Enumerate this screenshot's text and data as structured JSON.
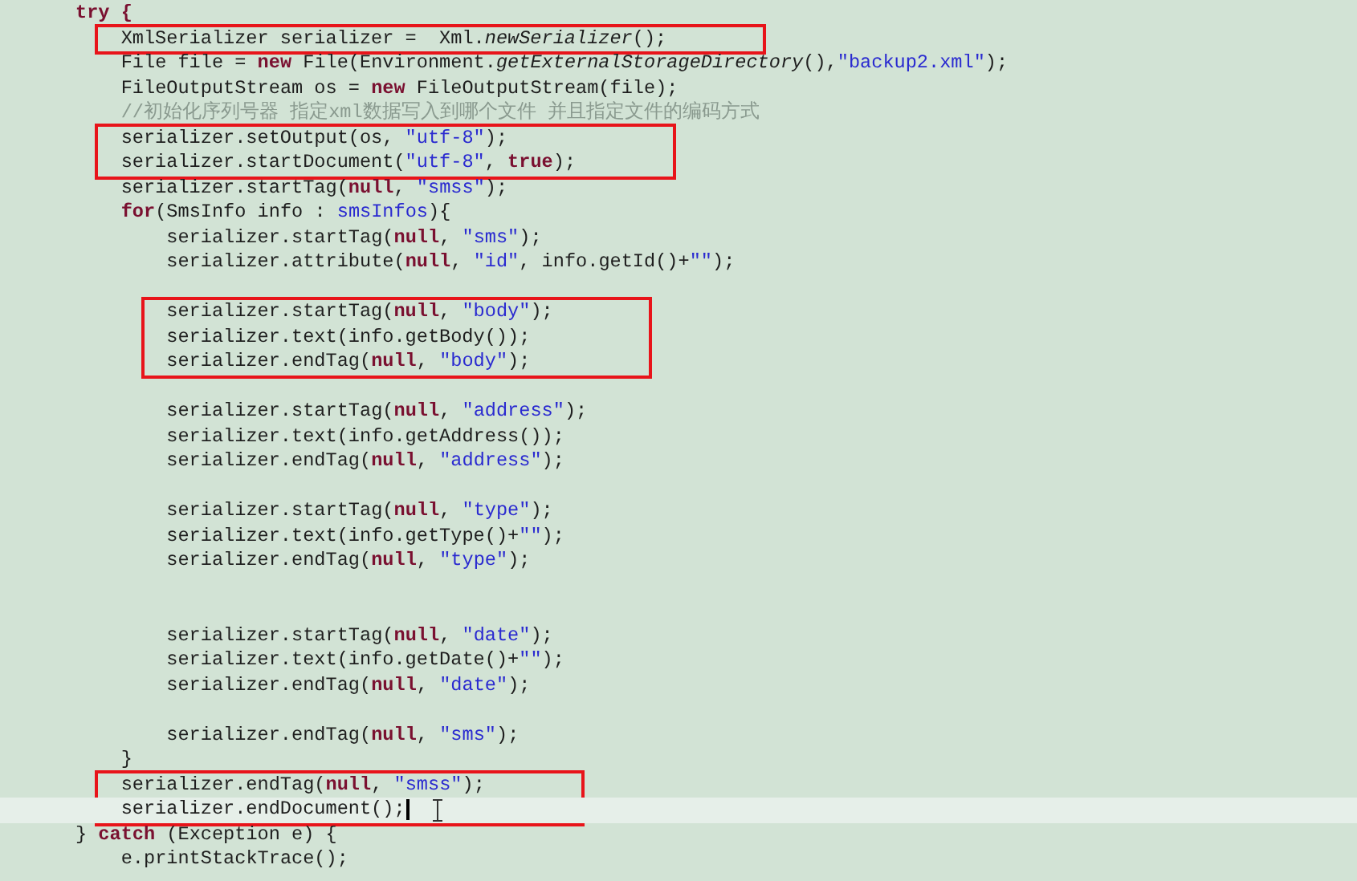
{
  "blocks": [
    {
      "kind": "line",
      "tokens": [
        {
          "text": "try {",
          "kind": "keyword"
        }
      ]
    },
    {
      "kind": "boxed",
      "lines": [
        {
          "tokens": [
            {
              "text": "    XmlSerializer serializer =  Xml.",
              "kind": "plain"
            },
            {
              "text": "newSerializer",
              "kind": "static"
            },
            {
              "text": "();",
              "kind": "plain"
            }
          ]
        }
      ]
    },
    {
      "kind": "line",
      "tokens": [
        {
          "text": "    File file = ",
          "kind": "plain"
        },
        {
          "text": "new",
          "kind": "keyword"
        },
        {
          "text": " File(Environment.",
          "kind": "plain"
        },
        {
          "text": "getExternalStorageDirectory",
          "kind": "static"
        },
        {
          "text": "(),",
          "kind": "plain"
        },
        {
          "text": "\"backup2.xml\"",
          "kind": "string"
        },
        {
          "text": ");",
          "kind": "plain"
        }
      ]
    },
    {
      "kind": "line",
      "tokens": [
        {
          "text": "    FileOutputStream os = ",
          "kind": "plain"
        },
        {
          "text": "new",
          "kind": "keyword"
        },
        {
          "text": " FileOutputStream(file);",
          "kind": "plain"
        }
      ]
    },
    {
      "kind": "line",
      "tokens": [
        {
          "text": "    //初始化序列号器 指定xml数据写入到哪个文件 并且指定文件的编码方式",
          "kind": "comment"
        }
      ]
    },
    {
      "kind": "boxed",
      "lines": [
        {
          "tokens": [
            {
              "text": "    serializer.setOutput(os, ",
              "kind": "plain"
            },
            {
              "text": "\"utf-8\"",
              "kind": "string"
            },
            {
              "text": ");",
              "kind": "plain"
            }
          ]
        },
        {
          "tokens": [
            {
              "text": "    serializer.startDocument(",
              "kind": "plain"
            },
            {
              "text": "\"utf-8\"",
              "kind": "string"
            },
            {
              "text": ", ",
              "kind": "plain"
            },
            {
              "text": "true",
              "kind": "keyword"
            },
            {
              "text": ");",
              "kind": "plain"
            }
          ]
        }
      ]
    },
    {
      "kind": "line",
      "tokens": [
        {
          "text": "    serializer.startTag(",
          "kind": "plain"
        },
        {
          "text": "null",
          "kind": "keyword"
        },
        {
          "text": ", ",
          "kind": "plain"
        },
        {
          "text": "\"smss\"",
          "kind": "string"
        },
        {
          "text": ");",
          "kind": "plain"
        }
      ]
    },
    {
      "kind": "line",
      "tokens": [
        {
          "text": "    for",
          "kind": "keyword"
        },
        {
          "text": "(SmsInfo info : ",
          "kind": "plain"
        },
        {
          "text": "smsInfos",
          "kind": "field"
        },
        {
          "text": "){",
          "kind": "plain"
        }
      ]
    },
    {
      "kind": "line",
      "tokens": [
        {
          "text": "        serializer.startTag(",
          "kind": "plain"
        },
        {
          "text": "null",
          "kind": "keyword"
        },
        {
          "text": ", ",
          "kind": "plain"
        },
        {
          "text": "\"sms\"",
          "kind": "string"
        },
        {
          "text": ");",
          "kind": "plain"
        }
      ]
    },
    {
      "kind": "line",
      "tokens": [
        {
          "text": "        serializer.attribute(",
          "kind": "plain"
        },
        {
          "text": "null",
          "kind": "keyword"
        },
        {
          "text": ", ",
          "kind": "plain"
        },
        {
          "text": "\"id\"",
          "kind": "string"
        },
        {
          "text": ", info.getId()+",
          "kind": "plain"
        },
        {
          "text": "\"\"",
          "kind": "string"
        },
        {
          "text": ");",
          "kind": "plain"
        }
      ]
    },
    {
      "kind": "blank"
    },
    {
      "kind": "boxed",
      "lines": [
        {
          "tokens": [
            {
              "text": "        serializer.startTag(",
              "kind": "plain"
            },
            {
              "text": "null",
              "kind": "keyword"
            },
            {
              "text": ", ",
              "kind": "plain"
            },
            {
              "text": "\"body\"",
              "kind": "string"
            },
            {
              "text": ");",
              "kind": "plain"
            }
          ]
        },
        {
          "tokens": [
            {
              "text": "        serializer.text(info.getBody());",
              "kind": "plain"
            }
          ]
        },
        {
          "tokens": [
            {
              "text": "        serializer.endTag(",
              "kind": "plain"
            },
            {
              "text": "null",
              "kind": "keyword"
            },
            {
              "text": ", ",
              "kind": "plain"
            },
            {
              "text": "\"body\"",
              "kind": "string"
            },
            {
              "text": ");",
              "kind": "plain"
            }
          ]
        }
      ]
    },
    {
      "kind": "blank"
    },
    {
      "kind": "line",
      "tokens": [
        {
          "text": "        serializer.startTag(",
          "kind": "plain"
        },
        {
          "text": "null",
          "kind": "keyword"
        },
        {
          "text": ", ",
          "kind": "plain"
        },
        {
          "text": "\"address\"",
          "kind": "string"
        },
        {
          "text": ");",
          "kind": "plain"
        }
      ]
    },
    {
      "kind": "line",
      "tokens": [
        {
          "text": "        serializer.text(info.getAddress());",
          "kind": "plain"
        }
      ]
    },
    {
      "kind": "line",
      "tokens": [
        {
          "text": "        serializer.endTag(",
          "kind": "plain"
        },
        {
          "text": "null",
          "kind": "keyword"
        },
        {
          "text": ", ",
          "kind": "plain"
        },
        {
          "text": "\"address\"",
          "kind": "string"
        },
        {
          "text": ");",
          "kind": "plain"
        }
      ]
    },
    {
      "kind": "blank"
    },
    {
      "kind": "line",
      "tokens": [
        {
          "text": "        serializer.startTag(",
          "kind": "plain"
        },
        {
          "text": "null",
          "kind": "keyword"
        },
        {
          "text": ", ",
          "kind": "plain"
        },
        {
          "text": "\"type\"",
          "kind": "string"
        },
        {
          "text": ");",
          "kind": "plain"
        }
      ]
    },
    {
      "kind": "line",
      "tokens": [
        {
          "text": "        serializer.text(info.getType()+",
          "kind": "plain"
        },
        {
          "text": "\"\"",
          "kind": "string"
        },
        {
          "text": ");",
          "kind": "plain"
        }
      ]
    },
    {
      "kind": "line",
      "tokens": [
        {
          "text": "        serializer.endTag(",
          "kind": "plain"
        },
        {
          "text": "null",
          "kind": "keyword"
        },
        {
          "text": ", ",
          "kind": "plain"
        },
        {
          "text": "\"type\"",
          "kind": "string"
        },
        {
          "text": ");",
          "kind": "plain"
        }
      ]
    },
    {
      "kind": "blank"
    },
    {
      "kind": "blank"
    },
    {
      "kind": "line",
      "tokens": [
        {
          "text": "        serializer.startTag(",
          "kind": "plain"
        },
        {
          "text": "null",
          "kind": "keyword"
        },
        {
          "text": ", ",
          "kind": "plain"
        },
        {
          "text": "\"date\"",
          "kind": "string"
        },
        {
          "text": ");",
          "kind": "plain"
        }
      ]
    },
    {
      "kind": "line",
      "tokens": [
        {
          "text": "        serializer.text(info.getDate()+",
          "kind": "plain"
        },
        {
          "text": "\"\"",
          "kind": "string"
        },
        {
          "text": ");",
          "kind": "plain"
        }
      ]
    },
    {
      "kind": "line",
      "tokens": [
        {
          "text": "        serializer.endTag(",
          "kind": "plain"
        },
        {
          "text": "null",
          "kind": "keyword"
        },
        {
          "text": ", ",
          "kind": "plain"
        },
        {
          "text": "\"date\"",
          "kind": "string"
        },
        {
          "text": ");",
          "kind": "plain"
        }
      ]
    },
    {
      "kind": "blank"
    },
    {
      "kind": "line",
      "tokens": [
        {
          "text": "        serializer.endTag(",
          "kind": "plain"
        },
        {
          "text": "null",
          "kind": "keyword"
        },
        {
          "text": ", ",
          "kind": "plain"
        },
        {
          "text": "\"sms\"",
          "kind": "string"
        },
        {
          "text": ");",
          "kind": "plain"
        }
      ]
    },
    {
      "kind": "line",
      "tokens": [
        {
          "text": "    }",
          "kind": "plain"
        }
      ]
    },
    {
      "kind": "boxed",
      "lines": [
        {
          "tokens": [
            {
              "text": "    serializer.endTag(",
              "kind": "plain"
            },
            {
              "text": "null",
              "kind": "keyword"
            },
            {
              "text": ", ",
              "kind": "plain"
            },
            {
              "text": "\"smss\"",
              "kind": "string"
            },
            {
              "text": ");",
              "kind": "plain"
            }
          ]
        },
        {
          "current": true,
          "tokens": [
            {
              "text": "    serializer.endDocument();",
              "kind": "plain"
            }
          ]
        }
      ]
    },
    {
      "kind": "line",
      "tokens": [
        {
          "text": "} ",
          "kind": "plain"
        },
        {
          "text": "catch",
          "kind": "keyword"
        },
        {
          "text": " (Exception e) {",
          "kind": "plain"
        }
      ]
    },
    {
      "kind": "line",
      "tokens": [
        {
          "text": "    e.printStackTrace();",
          "kind": "plain"
        }
      ]
    }
  ]
}
